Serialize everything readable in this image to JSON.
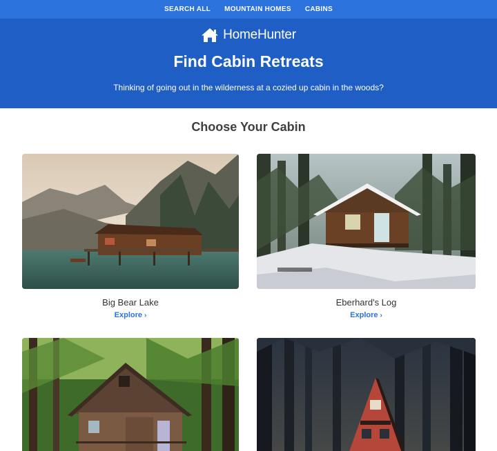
{
  "nav": {
    "items": [
      "SEARCH ALL",
      "MOUNTAIN HOMES",
      "CABINS"
    ]
  },
  "brand": {
    "name": "HomeHunter",
    "icon": "house-icon"
  },
  "hero": {
    "title": "Find Cabin Retreats",
    "subtitle": "Thinking of going out in the wilderness at a cozied up cabin in the woods?"
  },
  "section": {
    "title": "Choose Your Cabin"
  },
  "cards": [
    {
      "title": "Big Bear Lake",
      "link": "Explore"
    },
    {
      "title": "Eberhard's Log",
      "link": "Explore"
    },
    {
      "title": "",
      "link": ""
    },
    {
      "title": "",
      "link": ""
    }
  ],
  "colors": {
    "nav_bg": "#2b72dc",
    "hero_bg": "#1f5ec4",
    "link": "#2b72dc"
  }
}
